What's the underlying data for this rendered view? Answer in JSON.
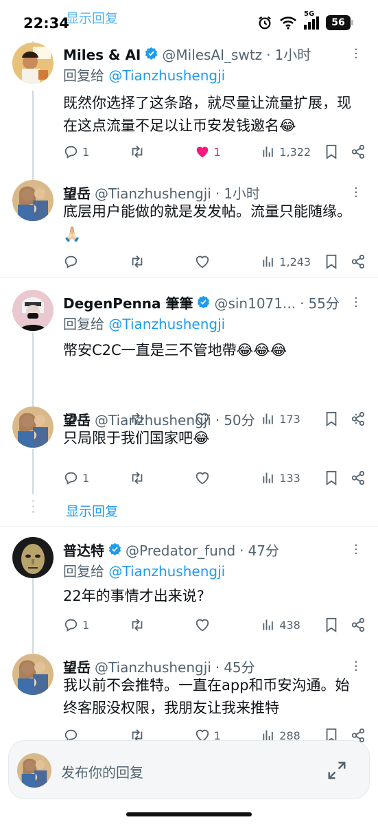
{
  "status_bar": {
    "time": "22:34",
    "network": "5G",
    "battery": "56",
    "overlay_text": "显示回复"
  },
  "posts": [
    {
      "name": "Miles & AI",
      "verified": true,
      "handle": "@MilesAI_swtz",
      "time": "1小时",
      "reply_prefix": "回复给",
      "reply_to": "@Tianzhushengji",
      "text": "既然你选择了这条路，就尽量让流量扩展，现在这点流量不足以让币安发钱邀名😂",
      "replies": "1",
      "retweets": "",
      "likes": "1",
      "liked": true,
      "views": "1,322"
    },
    {
      "name": "望岳",
      "verified": false,
      "handle": "@Tianzhushengji",
      "time": "1小时",
      "text": "底层用户能做的就是发发帖。流量只能随缘。🙏🏻",
      "replies": "",
      "retweets": "",
      "likes": "",
      "views": "1,243"
    },
    {
      "name": "DegenPenna 筆筆",
      "verified": true,
      "handle": "@sin1071...",
      "time": "55分",
      "reply_prefix": "回复给",
      "reply_to": "@Tianzhushengji",
      "text": "幣安C2C一直是三不管地帶😂😂😂",
      "replies": "1",
      "retweets": "",
      "likes": "",
      "views": "173"
    },
    {
      "name": "望岳",
      "verified": false,
      "handle": "@Tianzhushengji",
      "time": "50分",
      "text": "只局限于我们国家吧😂",
      "replies": "1",
      "retweets": "",
      "likes": "",
      "views": "133"
    },
    {
      "name": "普达特",
      "verified": true,
      "handle": "@Predator_fund",
      "time": "47分",
      "reply_prefix": "回复给",
      "reply_to": "@Tianzhushengji",
      "text": "22年的事情才出来说?",
      "replies": "1",
      "retweets": "",
      "likes": "",
      "views": "438"
    },
    {
      "name": "望岳",
      "verified": false,
      "handle": "@Tianzhushengji",
      "time": "45分",
      "text": "我以前不会推特。一直在app和币安沟通。始终客服没权限，我朋友让我来推特",
      "replies": "",
      "retweets": "",
      "likes": "1",
      "views": "288"
    }
  ],
  "show_replies_label": "显示回复",
  "composer": {
    "placeholder": "发布你的回复"
  },
  "colors": {
    "accent": "#1d9bf0",
    "like": "#f91880",
    "muted": "#536471",
    "verified": "#1d9bf0"
  }
}
